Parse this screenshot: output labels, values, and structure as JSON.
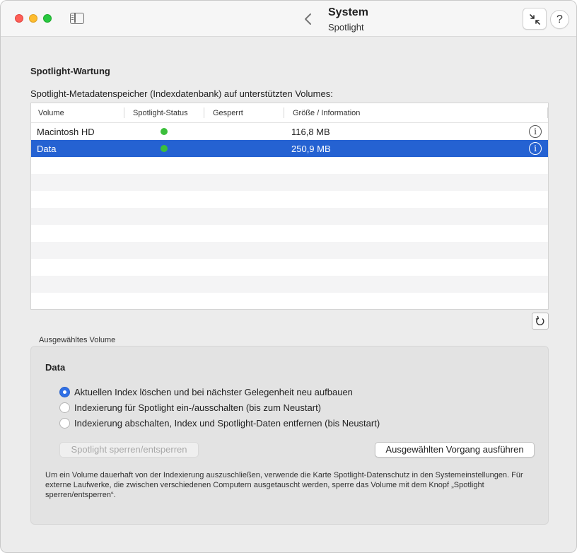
{
  "titlebar": {
    "title": "System",
    "subtitle": "Spotlight"
  },
  "section": {
    "title": "Spotlight-Wartung",
    "table_caption": "Spotlight-Metadatenspeicher (Indexdatenbank) auf unterstützten Volumes:"
  },
  "table": {
    "headers": [
      "Volume",
      "Spotlight-Status",
      "Gesperrt",
      "Größe / Information"
    ],
    "rows": [
      {
        "volume": "Macintosh HD",
        "status_color": "#3bbf3b",
        "locked": "",
        "size": "116,8 MB"
      },
      {
        "volume": "Data",
        "status_color": "#3bbf3b",
        "locked": "",
        "size": "250,9 MB",
        "selected": true
      }
    ]
  },
  "selected_volume": {
    "group_label": "Ausgewähltes Volume",
    "name": "Data",
    "options": [
      {
        "label": "Aktuellen Index löschen und bei nächster Gelegenheit neu aufbauen",
        "checked": true
      },
      {
        "label": "Indexierung für Spotlight ein-/ausschalten (bis zum Neustart)",
        "checked": false
      },
      {
        "label": "Indexierung abschalten, Index und Spotlight-Daten entfernen (bis Neustart)",
        "checked": false
      }
    ],
    "lock_button": "Spotlight sperren/entsperren",
    "run_button": "Ausgewählten Vorgang ausführen",
    "note": "Um ein Volume dauerhaft von der Indexierung auszuschließen, verwende die Karte Spotlight-Datenschutz in den Systemeinstellungen. Für externe Laufwerke, die zwischen verschiedenen Computern ausgetauscht werden, sperre das Volume mit dem Knopf „Spotlight sperren/entsperren“."
  },
  "icons": {
    "help": "?",
    "info": "i",
    "accent_color": "#2562d2"
  }
}
